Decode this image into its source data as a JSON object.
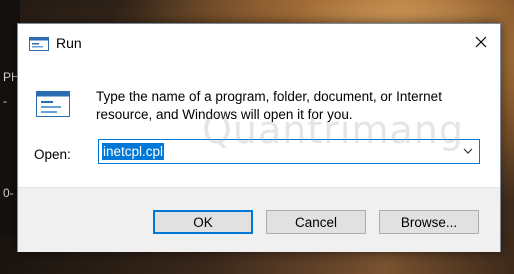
{
  "desktop": {
    "left_text_1": "PH",
    "left_text_2": "-",
    "left_text_3": "0-"
  },
  "dialog": {
    "title": "Run",
    "description": "Type the name of a program, folder, document, or Internet resource, and Windows will open it for you.",
    "open_label": "Open:",
    "open_value": "inetcpl.cpl",
    "buttons": {
      "ok": "OK",
      "cancel": "Cancel",
      "browse": "Browse..."
    }
  },
  "watermark": "Quantrimang",
  "colors": {
    "accent": "#0078d7",
    "dialog_bg": "#f0f0f0",
    "button_bg": "#e1e1e1"
  },
  "icons": {
    "title": "run-icon",
    "main": "run-icon",
    "close": "close-icon",
    "dropdown": "chevron-down-icon"
  }
}
